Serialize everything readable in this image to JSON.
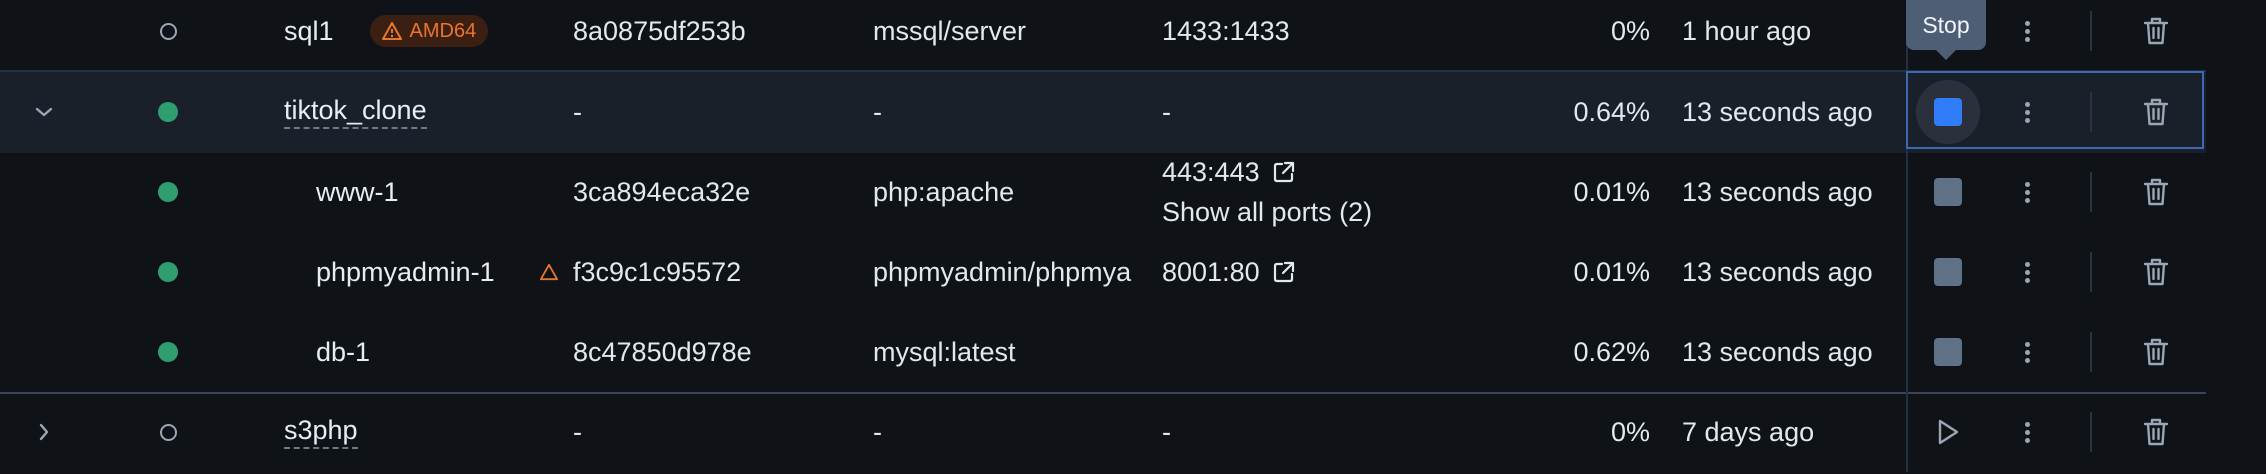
{
  "tooltip": {
    "text": "Stop"
  },
  "rows": [
    {
      "expander": "",
      "status": "stopped",
      "name": "sql1",
      "badge": "AMD64",
      "container_id": "8a0875df253b",
      "image": "mssql/server",
      "ports": [
        "1433:1433"
      ],
      "cpu": "0%",
      "last_started": "1 hour ago",
      "action": "start-or-stop"
    },
    {
      "expander": "collapse",
      "status": "running",
      "name": "tiktok_clone",
      "container_id": "-",
      "image": "-",
      "ports": [
        "-"
      ],
      "cpu": "0.64%",
      "last_started": "13 seconds ago",
      "action": "stop"
    },
    {
      "status": "running",
      "name": "www-1",
      "container_id": "3ca894eca32e",
      "image": "php:apache",
      "ports": [
        "443:443"
      ],
      "ports_more": "Show all ports (2)",
      "cpu": "0.01%",
      "last_started": "13 seconds ago",
      "action": "stop"
    },
    {
      "status": "running",
      "name": "phpmyadmin-1",
      "container_id": "f3c9c1c95572",
      "image": "phpmyadmin/phpmya",
      "ports": [
        "8001:80"
      ],
      "cpu": "0.01%",
      "last_started": "13 seconds ago",
      "action": "stop"
    },
    {
      "status": "running",
      "name": "db-1",
      "container_id": "8c47850d978e",
      "image": "mysql:latest",
      "ports": [
        ""
      ],
      "cpu": "0.62%",
      "last_started": "13 seconds ago",
      "action": "stop"
    },
    {
      "expander": "expand",
      "status": "stopped",
      "name": "s3php",
      "container_id": "-",
      "image": "-",
      "ports": [
        "-"
      ],
      "cpu": "0%",
      "last_started": "7 days ago",
      "action": "start"
    }
  ],
  "colors": {
    "background": "#0f1318",
    "selected_row": "#1a2029",
    "running": "#2e9e6e",
    "warning": "#e9762a",
    "accent": "#2f7df6"
  }
}
